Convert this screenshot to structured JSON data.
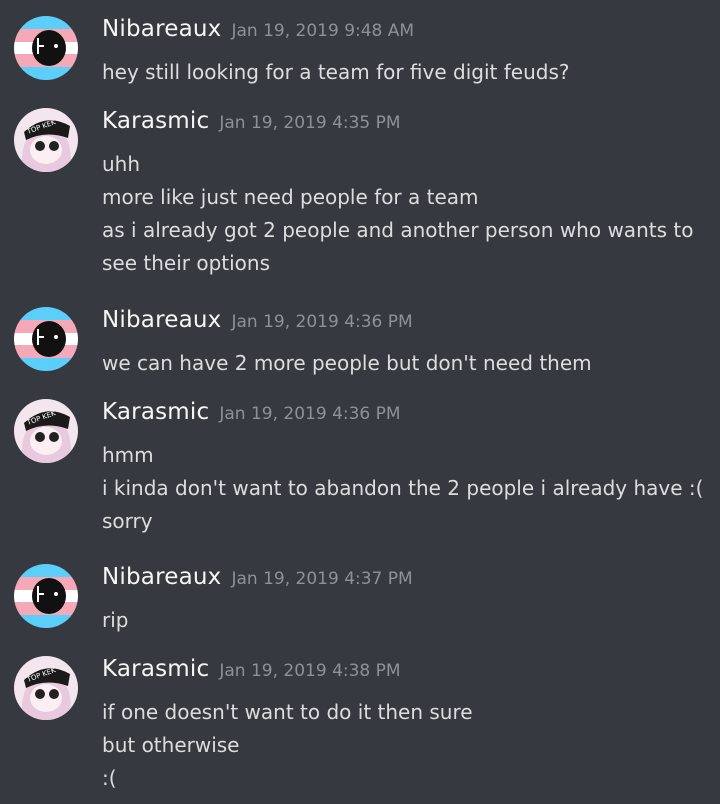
{
  "messages": [
    {
      "author": "Nibareaux",
      "avatar_icon": "trans-flag-ghost-avatar-icon",
      "timestamp": "Jan 19, 2019 9:48 AM",
      "lines": [
        "hey still looking for a team for five digit feuds?"
      ]
    },
    {
      "author": "Karasmic",
      "avatar_icon": "top-kek-anime-girl-avatar-icon",
      "avatar_text": "TOP KEK",
      "timestamp": "Jan 19, 2019 4:35 PM",
      "lines": [
        "uhh",
        "more like just need people for a team",
        "as i already got 2 people and another person who wants to",
        "see their options"
      ]
    },
    {
      "author": "Nibareaux",
      "avatar_icon": "trans-flag-ghost-avatar-icon",
      "timestamp": "Jan 19, 2019 4:36 PM",
      "lines": [
        "we can have 2 more people but don't need them"
      ]
    },
    {
      "author": "Karasmic",
      "avatar_icon": "top-kek-anime-girl-avatar-icon",
      "avatar_text": "TOP KEK",
      "timestamp": "Jan 19, 2019 4:36 PM",
      "lines": [
        "hmm",
        "i kinda don't want to abandon the 2 people i already have :(",
        "sorry"
      ]
    },
    {
      "author": "Nibareaux",
      "avatar_icon": "trans-flag-ghost-avatar-icon",
      "timestamp": "Jan 19, 2019 4:37 PM",
      "lines": [
        "rip"
      ]
    },
    {
      "author": "Karasmic",
      "avatar_icon": "top-kek-anime-girl-avatar-icon",
      "avatar_text": "TOP KEK",
      "timestamp": "Jan 19, 2019 4:38 PM",
      "lines": [
        "if one doesn't want to do it then sure",
        "but otherwise",
        ":("
      ]
    }
  ],
  "colors": {
    "background": "#36393f",
    "username": "#f6f6f7",
    "timestamp": "#8e9297",
    "message_text": "#dcddde",
    "trans_blue": "#5bcefa",
    "trans_pink": "#f5a9b8",
    "trans_white": "#ffffff"
  }
}
